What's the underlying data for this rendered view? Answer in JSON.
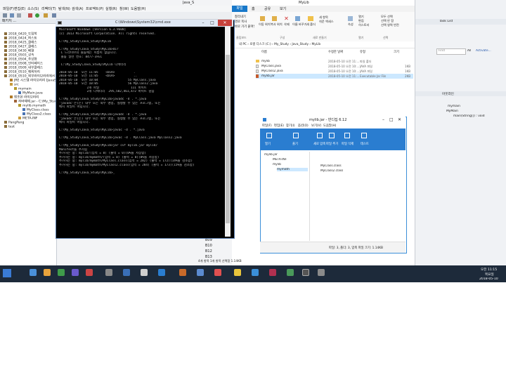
{
  "eclipse": {
    "title": "Java_S",
    "menu": [
      "파일(F)",
      "편집(E)",
      "소스(S)",
      "리팩터(T)",
      "탐색(N)",
      "검색(A)",
      "프로젝트(P)",
      "실행(R)",
      "창(W)",
      "도움말(H)"
    ],
    "package_explorer_title": "패키지 ...",
    "tree": [
      "2018_0420_도입학",
      "2018_0424_퍼스트",
      "2018_0425_클래스",
      "2018_0427_클래스",
      "2018_0430_배열",
      "2018_0503_상속",
      "2018_0504_추상화",
      "2018_0508_인터페이스",
      "2018_0509_내부클래스",
      "2018_0510_예외처리",
      "2018_0510_외부라이브러리에서",
      "JRE 시스템 라이브러리 [JavaSE-1.8]",
      "src",
      "mymain",
      "MyMain.java",
      "참조된 라이브러리",
      "자바예제.jar - C:\\My_Study",
      "mylib.mymath",
      "MyClass.class",
      "MyClass2.class",
      "META-INF",
      "PangPang",
      "test"
    ],
    "side_numbers": [
      "B09",
      "B10",
      "B12",
      "B13"
    ],
    "version": "6.0.247)",
    "right_panel": {
      "task_list": "Task List",
      "find_placeholder": "Find",
      "filter_all": "All",
      "activate": "Activate...",
      "outline_title": "아웃라인",
      "outline_items": [
        "mymain",
        "MyMain",
        "main(String[]) : void"
      ]
    }
  },
  "explorer": {
    "title": "MyLib",
    "tabs": [
      "파일",
      "홈",
      "공유",
      "보기"
    ],
    "ribbon": [
      "잘라내기",
      "경로 복사",
      "바로 가기 붙여넣기",
      "이동 위치",
      "복사 위치",
      "삭제",
      "이름 바꾸기",
      "새 폴더",
      "새 항목",
      "쉬운 액세스",
      "속성",
      "열기",
      "편집",
      "히스토리",
      "모두 선택",
      "선택 안 함",
      "선택 영역 반전"
    ],
    "groups": [
      "클립보드",
      "구성",
      "새로 만들기",
      "열기",
      "선택"
    ],
    "breadcrumb": [
      "내 PC",
      "로컬 디스크 (C:)",
      "My_Study",
      "Java_Study",
      "MyLib"
    ],
    "columns": [
      "이름",
      "수정한 날짜",
      "유형",
      "크기"
    ],
    "files": [
      {
        "name": "mylib",
        "date": "2018-05-10 오전 11:...",
        "type": "파일 폴더",
        "size": ""
      },
      {
        "name": "MyClass.java",
        "date": "2018-05-10 오전 10:...",
        "type": "JAVA 파일",
        "size": "1KB"
      },
      {
        "name": "MyClass2.java",
        "date": "2018-05-10 오전 10:...",
        "type": "JAVA 파일",
        "size": "1KB"
      },
      {
        "name": "mylib.jar",
        "date": "2018-05-10 오전 11:...",
        "type": "Executable Jar File",
        "size": "2KB"
      }
    ],
    "status": "4개 항목  1개 항목 선택함 1.14KB"
  },
  "cmd": {
    "title": "C:\\Windows\\System32\\cmd.exe",
    "lines": [
      "Microsoft Windows [Version 6.3.9600]",
      "(c) 2013 Microsoft Corporation. All rights reserved.",
      "",
      "C:\\My_Study\\Java_Study\\MyLib",
      "",
      "C:\\My_Study\\Java_Study\\MyLib>dir",
      " C 드라이브의 볼륨에는 이름이 없습니다.",
      " 볼륨 일련 번호: 8477-3FEC",
      "",
      " C:\\My_Study\\Java_Study\\MyLib 디렉터리",
      "",
      "2018-05-10  오전 11:05    <DIR>          .",
      "2018-05-10  오전 11:05    <DIR>          ..",
      "2018-05-10  오전 10:04                55 MyClass.java",
      "2018-05-10  오전 10:05                56 MyClass2.java",
      "               2개 파일                 111 바이트",
      "               2개 디렉터리  295,582,461,472 바이트 남음",
      "",
      "C:\\My_Study\\Java_Study\\MyLib>javadc -d . *.java",
      "'javadc'은(는) 내부 또는 외부 명령, 실행할 수 있는 프로그램, 또는",
      "배치 파일이 아닙니다.",
      "",
      "C:\\My_Study\\Java_Study\\MyLib>javadc -d . *.java",
      "'javadc'은(는) 내부 또는 외부 명령, 실행할 수 있는 프로그램, 또는",
      "배치 파일이 아닙니다.",
      "",
      "C:\\My_Study\\Java_Study\\MyLib>javac -d . *.java",
      "",
      "C:\\My_Study\\Java_Study\\MyLib>javac -d . MyClass.java MyClass2.java",
      "",
      "C:\\My_Study\\Java_Study\\MyLib>jar cvf mylib.jar mylib/",
      "Manifest를 추가됨",
      "추가하는 중: mylib/(입력 = 0) (출력 = 0)(0%를 저장함)",
      "추가하는 중: mylib/mymath/(입력 = 0) (출력 = 0)(0%를 저장함)",
      "추가하는 중: mylib/mymath/MyClass.class(입력 = 282) (출력 = 172)(14%를 감소함)",
      "추가하는 중: mylib/mymath/MyClass2.class(입력 = 284) (출력 = 173)(15%를 감소함)",
      "",
      "C:\\My_Study\\Java_Study\\MyLib>_"
    ]
  },
  "bandizip": {
    "title": "mylib.jar - 반디집 6.12",
    "menu": [
      "파일(F)",
      "편집(E)",
      "찾기(I)",
      "옵션(O)",
      "보기(V)",
      "도움말(H)"
    ],
    "toolbar": [
      "열기",
      "풀기",
      "새로 압축",
      "파일 추가",
      "파일 삭제",
      "테스트"
    ],
    "tree": [
      "mylib.jar",
      "META-INF",
      "mylib",
      "mymath"
    ],
    "files": [
      "MyClass.class",
      "MyClass2.class"
    ],
    "status": "파일: 3, 폴더: 3, 압축 파일 크기: 1.14KB"
  },
  "taskbar": {
    "time": "오전 11:15",
    "day": "목요일",
    "date": "2018-05-10"
  }
}
